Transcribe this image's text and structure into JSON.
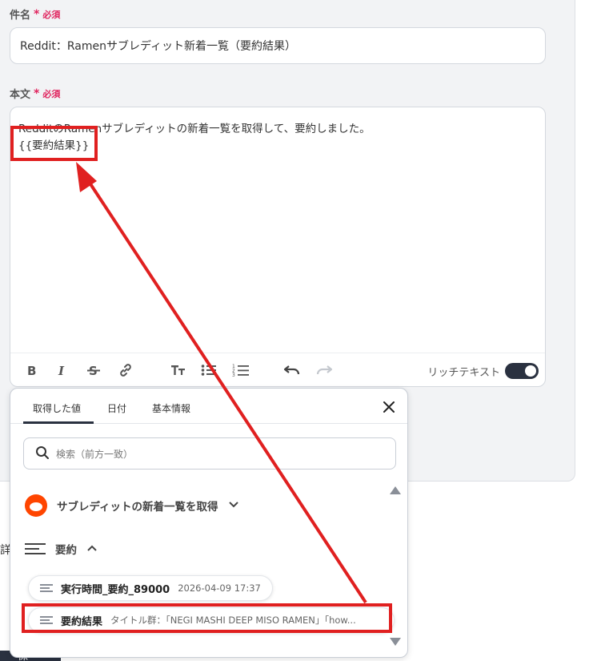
{
  "subject": {
    "label": "件名",
    "required_star": "*",
    "required_text": "必須",
    "value": "Reddit：Ramenサブレディット新着一覧（要約結果）"
  },
  "body": {
    "label": "本文",
    "required_star": "*",
    "required_text": "必須",
    "line1": "RedditのRamenサブレディットの新着一覧を取得して、要約しました。",
    "line2": "{{要約結果}}",
    "rich_text_label": "リッチテキスト",
    "rich_text_on": true
  },
  "toolbar": {
    "icons": [
      "bold-icon",
      "italic-icon",
      "strikethrough-icon",
      "link-icon",
      "text-size-icon",
      "bullet-list-icon",
      "numbered-list-icon",
      "undo-icon",
      "redo-icon"
    ]
  },
  "popup": {
    "tabs": [
      {
        "label": "取得した値",
        "active": true
      },
      {
        "label": "日付",
        "active": false
      },
      {
        "label": "基本情報",
        "active": false
      }
    ],
    "search_placeholder": "検索（前方一致）",
    "groups": [
      {
        "label": "サブレディットの新着一覧を取得",
        "icon": "reddit-icon",
        "expanded": false
      },
      {
        "label": "要約",
        "icon": "lines-icon",
        "expanded": true
      }
    ],
    "items": [
      {
        "name": "実行時間_要約_89000",
        "value": "2026-04-09 17:37"
      },
      {
        "name": "要約結果",
        "value": "タイトル群：「NEGI MASHI DEEP MISO RAMEN」「how..."
      }
    ]
  },
  "side_char": "詳",
  "bottom_tab": "保",
  "colors": {
    "accent": "#2a3140",
    "required": "#e0245e",
    "highlight": "#e02020",
    "reddit": "#ff4500"
  }
}
